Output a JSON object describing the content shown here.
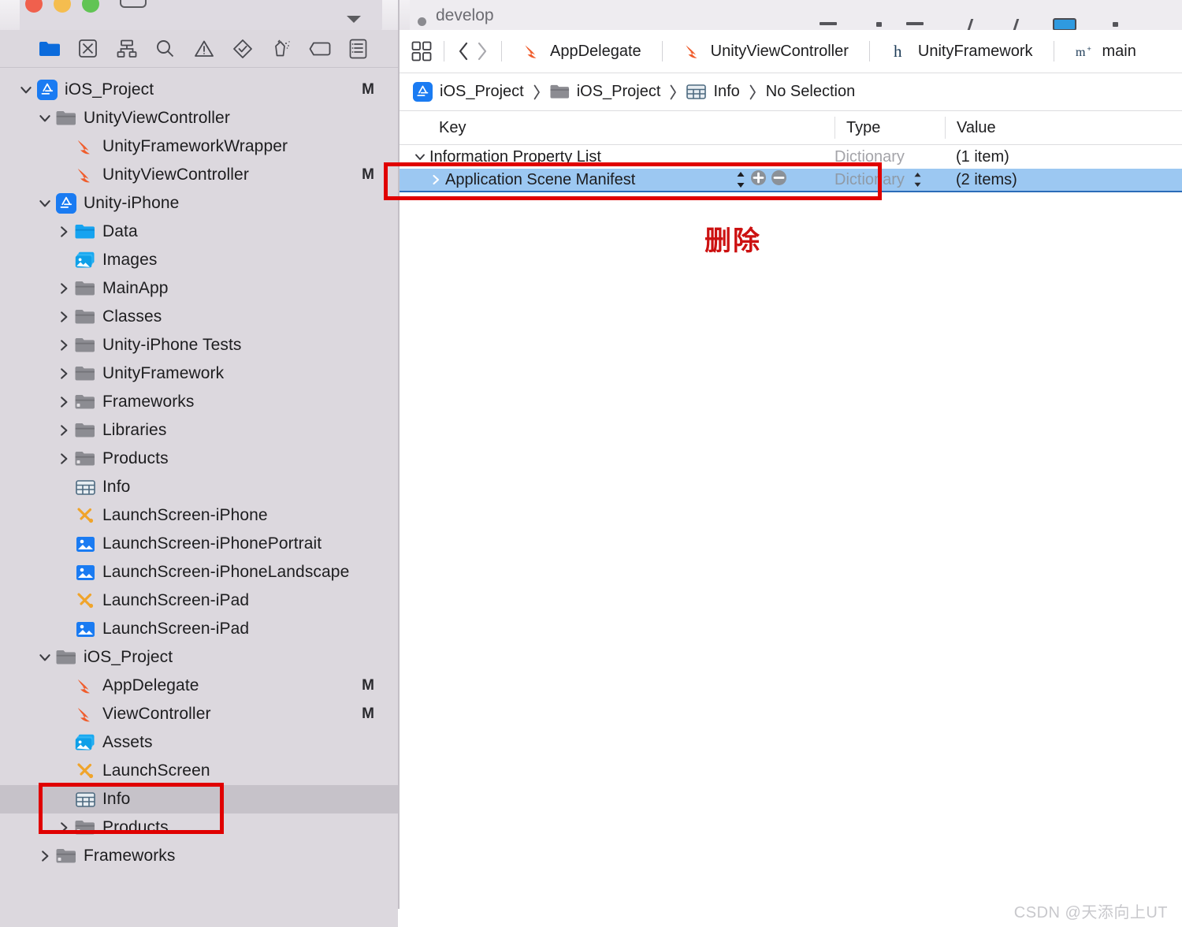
{
  "window": {
    "branch_label": "develop",
    "traffic_lights": [
      "close-red",
      "minimize-yellow",
      "zoom-green"
    ]
  },
  "navigator": {
    "toolbar_icons": [
      {
        "name": "project-navigator-icon",
        "active": true
      },
      {
        "name": "source-control-navigator-icon",
        "active": false
      },
      {
        "name": "symbol-navigator-icon",
        "active": false
      },
      {
        "name": "find-navigator-icon",
        "active": false
      },
      {
        "name": "issue-navigator-icon",
        "active": false
      },
      {
        "name": "test-navigator-icon",
        "active": false
      },
      {
        "name": "debug-navigator-icon",
        "active": false
      },
      {
        "name": "breakpoint-navigator-icon",
        "active": false
      },
      {
        "name": "report-navigator-icon",
        "active": false
      }
    ],
    "tree": [
      {
        "label": "iOS_Project",
        "icon": "xcode-project-icon",
        "indent": 0,
        "twisty": "down",
        "badge": "M",
        "selected": false
      },
      {
        "label": "UnityViewController",
        "icon": "group-folder-icon",
        "indent": 1,
        "twisty": "down",
        "badge": "",
        "selected": false
      },
      {
        "label": "UnityFrameworkWrapper",
        "icon": "swift-file-icon",
        "indent": 2,
        "twisty": "none",
        "badge": "",
        "selected": false
      },
      {
        "label": "UnityViewController",
        "icon": "swift-file-icon",
        "indent": 2,
        "twisty": "none",
        "badge": "M",
        "selected": false
      },
      {
        "label": "Unity-iPhone",
        "icon": "xcode-project-icon",
        "indent": 1,
        "twisty": "down",
        "badge": "",
        "selected": false
      },
      {
        "label": "Data",
        "icon": "blue-folder-icon",
        "indent": 2,
        "twisty": "right",
        "badge": "",
        "selected": false
      },
      {
        "label": "Images",
        "icon": "asset-catalog-icon",
        "indent": 2,
        "twisty": "none",
        "badge": "",
        "selected": false
      },
      {
        "label": "MainApp",
        "icon": "group-folder-icon",
        "indent": 2,
        "twisty": "right",
        "badge": "",
        "selected": false
      },
      {
        "label": "Classes",
        "icon": "group-folder-icon",
        "indent": 2,
        "twisty": "right",
        "badge": "",
        "selected": false
      },
      {
        "label": "Unity-iPhone Tests",
        "icon": "group-folder-icon",
        "indent": 2,
        "twisty": "right",
        "badge": "",
        "selected": false
      },
      {
        "label": "UnityFramework",
        "icon": "group-folder-icon",
        "indent": 2,
        "twisty": "right",
        "badge": "",
        "selected": false
      },
      {
        "label": "Frameworks",
        "icon": "frameworks-folder-icon",
        "indent": 2,
        "twisty": "right",
        "badge": "",
        "selected": false
      },
      {
        "label": "Libraries",
        "icon": "group-folder-icon",
        "indent": 2,
        "twisty": "right",
        "badge": "",
        "selected": false
      },
      {
        "label": "Products",
        "icon": "frameworks-folder-icon",
        "indent": 2,
        "twisty": "right",
        "badge": "",
        "selected": false
      },
      {
        "label": "Info",
        "icon": "plist-icon",
        "indent": 2,
        "twisty": "none",
        "badge": "",
        "selected": false
      },
      {
        "label": "LaunchScreen-iPhone",
        "icon": "storyboard-icon",
        "indent": 2,
        "twisty": "none",
        "badge": "",
        "selected": false
      },
      {
        "label": "LaunchScreen-iPhonePortrait",
        "icon": "image-file-icon",
        "indent": 2,
        "twisty": "none",
        "badge": "",
        "selected": false
      },
      {
        "label": "LaunchScreen-iPhoneLandscape",
        "icon": "image-file-icon",
        "indent": 2,
        "twisty": "none",
        "badge": "",
        "selected": false
      },
      {
        "label": "LaunchScreen-iPad",
        "icon": "storyboard-icon",
        "indent": 2,
        "twisty": "none",
        "badge": "",
        "selected": false
      },
      {
        "label": "LaunchScreen-iPad",
        "icon": "image-file-icon",
        "indent": 2,
        "twisty": "none",
        "badge": "",
        "selected": false
      },
      {
        "label": "iOS_Project",
        "icon": "group-folder-icon",
        "indent": 1,
        "twisty": "down",
        "badge": "",
        "selected": false
      },
      {
        "label": "AppDelegate",
        "icon": "swift-file-icon",
        "indent": 2,
        "twisty": "none",
        "badge": "M",
        "selected": false
      },
      {
        "label": "ViewController",
        "icon": "swift-file-icon",
        "indent": 2,
        "twisty": "none",
        "badge": "M",
        "selected": false
      },
      {
        "label": "Assets",
        "icon": "asset-catalog-icon",
        "indent": 2,
        "twisty": "none",
        "badge": "",
        "selected": false
      },
      {
        "label": "LaunchScreen",
        "icon": "storyboard-icon",
        "indent": 2,
        "twisty": "none",
        "badge": "",
        "selected": false
      },
      {
        "label": "Info",
        "icon": "plist-icon",
        "indent": 2,
        "twisty": "none",
        "badge": "",
        "selected": true
      },
      {
        "label": "Products",
        "icon": "frameworks-folder-icon",
        "indent": 2,
        "twisty": "right",
        "badge": "",
        "selected": false
      },
      {
        "label": "Frameworks",
        "icon": "frameworks-folder-icon",
        "indent": 1,
        "twisty": "right",
        "badge": "",
        "selected": false
      }
    ]
  },
  "editor": {
    "tabs": [
      {
        "label": "AppDelegate",
        "icon": "swift-file-icon"
      },
      {
        "label": "UnityViewController",
        "icon": "swift-file-icon"
      },
      {
        "label": "UnityFramework",
        "icon": "header-file-icon"
      },
      {
        "label": "main",
        "icon": "objc-file-icon"
      }
    ],
    "breadcrumb": [
      {
        "label": "iOS_Project",
        "icon": "xcode-project-icon"
      },
      {
        "label": "iOS_Project",
        "icon": "group-folder-icon"
      },
      {
        "label": "Info",
        "icon": "plist-icon"
      },
      {
        "label": "No Selection",
        "icon": "none"
      }
    ],
    "plist": {
      "columns": {
        "key": "Key",
        "type": "Type",
        "value": "Value"
      },
      "rows": [
        {
          "key": "Information Property List",
          "type": "Dictionary",
          "value": "(1 item)",
          "twisty": "down",
          "indent": 0,
          "selected": false
        },
        {
          "key": "Application Scene Manifest",
          "type": "Dictionary",
          "value": "(2 items)",
          "twisty": "right",
          "indent": 1,
          "selected": true
        }
      ]
    }
  },
  "annotations": {
    "note_text": "删除",
    "note_color": "#cc1111",
    "box_color": "#e00000"
  },
  "watermark": {
    "text": "CSDN @天添向上UT"
  }
}
